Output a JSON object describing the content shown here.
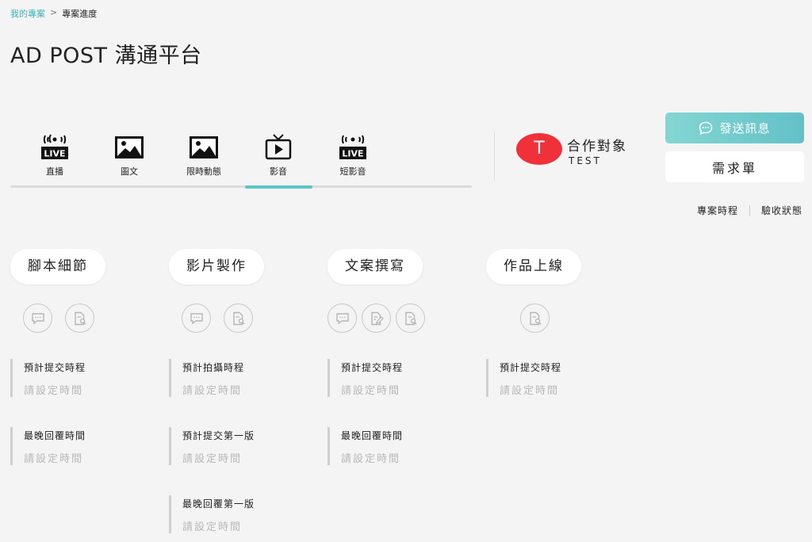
{
  "breadcrumb": {
    "link": "我的專案",
    "separator": ">",
    "current": "專案進度"
  },
  "page_title": "AD POST 溝通平台",
  "tabs": [
    {
      "label": "直播",
      "icon": "live-icon"
    },
    {
      "label": "圖文",
      "icon": "image-icon"
    },
    {
      "label": "限時動態",
      "icon": "image-icon"
    },
    {
      "label": "影音",
      "icon": "tv-play-icon",
      "active": true
    },
    {
      "label": "短影音",
      "icon": "live-icon"
    }
  ],
  "live_badge": "LIVE",
  "partner": {
    "avatar_letter": "T",
    "title": "合作對象",
    "name": "TEST",
    "avatar_color": "#f0313a"
  },
  "buttons": {
    "send_message": "發送訊息",
    "requirements": "需求單"
  },
  "links": {
    "schedule": "專案時程",
    "acceptance": "驗收狀態"
  },
  "accent_color": "#5cc3c8",
  "columns": [
    {
      "title": "腳本細節",
      "actions": [
        "comment-icon",
        "document-search-icon"
      ],
      "fields": [
        {
          "label": "預計提交時程",
          "value": "請設定時間"
        },
        {
          "label": "最晚回覆時間",
          "value": "請設定時間"
        }
      ]
    },
    {
      "title": "影片製作",
      "actions": [
        "comment-icon",
        "document-search-icon"
      ],
      "fields": [
        {
          "label": "預計拍攝時程",
          "value": "請設定時間"
        },
        {
          "label": "預計提交第一版",
          "value": "請設定時間"
        },
        {
          "label": "最晚回覆第一版",
          "value": "請設定時間"
        }
      ]
    },
    {
      "title": "文案撰寫",
      "actions": [
        "comment-icon",
        "document-edit-icon",
        "document-search-icon"
      ],
      "fields": [
        {
          "label": "預計提交時程",
          "value": "請設定時間"
        },
        {
          "label": "最晚回覆時間",
          "value": "請設定時間"
        }
      ]
    },
    {
      "title": "作品上線",
      "actions": [
        "document-search-icon"
      ],
      "fields": [
        {
          "label": "預計提交時程",
          "value": "請設定時間"
        }
      ]
    }
  ]
}
